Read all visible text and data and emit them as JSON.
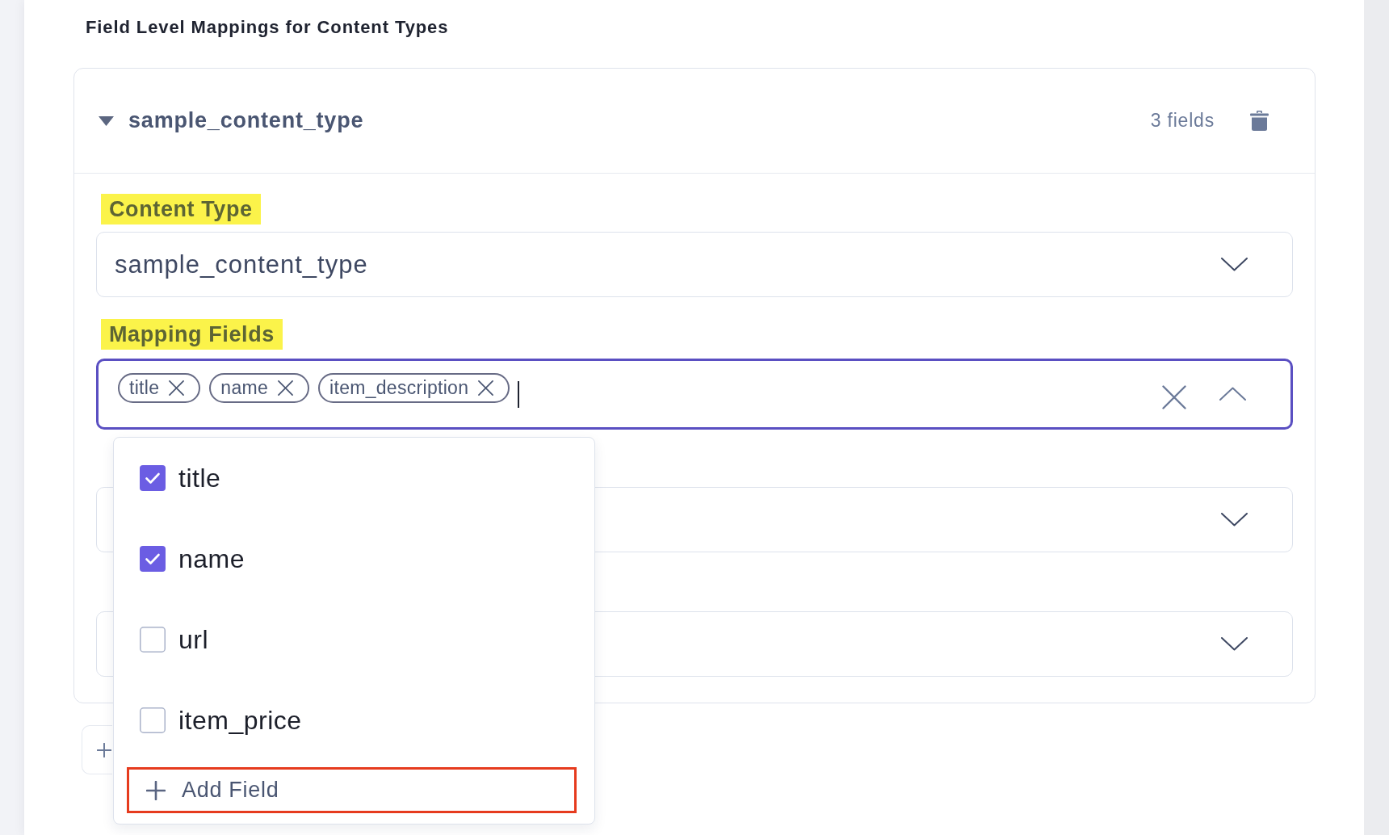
{
  "section_title": "Field Level Mappings for Content Types",
  "mapping": {
    "expanded": true,
    "title": "sample_content_type",
    "field_count": "3 fields",
    "content_type": {
      "label": {
        "text": "Content Type",
        "highlighted": true
      },
      "value": "sample_content_type",
      "open": false
    },
    "mapping_fields": {
      "label": {
        "text": "Mapping Fields",
        "highlighted": true
      },
      "focused": true,
      "open": true,
      "chips": [
        {
          "label": "title"
        },
        {
          "label": "name"
        },
        {
          "label": "item_description"
        }
      ],
      "options": [
        {
          "label": "title",
          "checked": true
        },
        {
          "label": "name",
          "checked": true
        },
        {
          "label": "url",
          "checked": false
        },
        {
          "label": "item_price",
          "checked": false
        }
      ],
      "add_field": {
        "label": "Add Field",
        "highlighted": true
      }
    },
    "more_selects": [
      {
        "open": false
      },
      {
        "open": false
      }
    ]
  }
}
